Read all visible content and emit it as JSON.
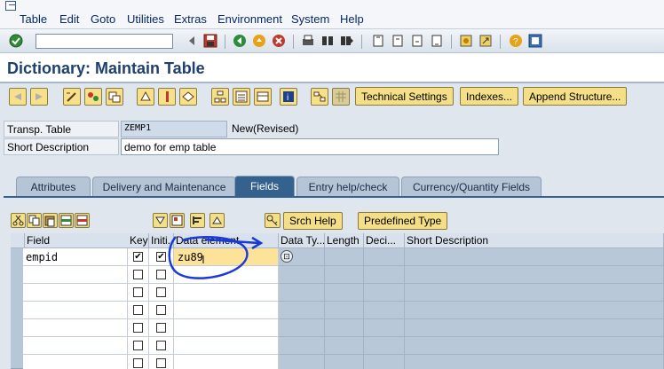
{
  "menu": [
    {
      "label": "Table"
    },
    {
      "label": "Edit"
    },
    {
      "label": "Goto"
    },
    {
      "label": "Utilities"
    },
    {
      "label": "Extras"
    },
    {
      "label": "Environment"
    },
    {
      "label": "System"
    },
    {
      "label": "Help"
    }
  ],
  "command_field": {
    "value": ""
  },
  "title": "Dictionary: Maintain Table",
  "app_toolbar": {
    "technical_settings": "Technical Settings",
    "indexes": "Indexes...",
    "append_structure": "Append Structure..."
  },
  "header": {
    "transp_table_label": "Transp. Table",
    "transp_table_value": "ZEMP1",
    "status": "New(Revised)",
    "short_desc_label": "Short Description",
    "short_desc_value": "demo for emp table"
  },
  "tabs": [
    {
      "label": "Attributes",
      "active": false
    },
    {
      "label": "Delivery and Maintenance",
      "active": false
    },
    {
      "label": "Fields",
      "active": true
    },
    {
      "label": "Entry help/check",
      "active": false
    },
    {
      "label": "Currency/Quantity Fields",
      "active": false
    }
  ],
  "table_toolbar": {
    "srch_help": "Srch Help",
    "predefined_type": "Predefined Type"
  },
  "columns": [
    "Field",
    "Key",
    "Initi...",
    "Data element",
    "Data Ty...",
    "Length",
    "Deci...",
    "Short Description"
  ],
  "rows": [
    {
      "field": "empid",
      "key": "✔",
      "initial": "✔",
      "data_element": "zu89"
    }
  ],
  "colors": {
    "accent": "#34618e",
    "button": "#f4de86",
    "annotation": "#1a3ad8"
  }
}
